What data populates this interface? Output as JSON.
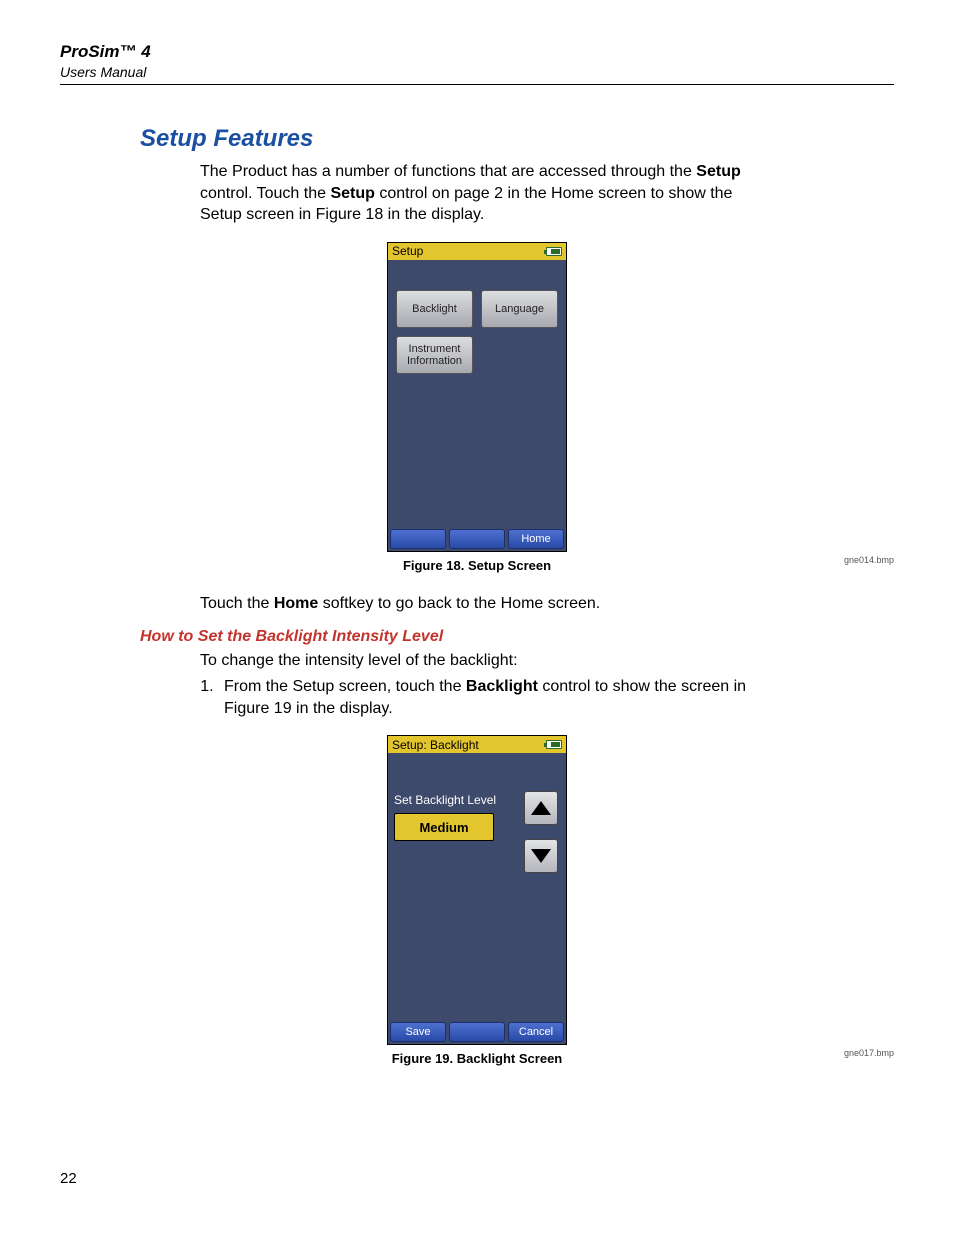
{
  "header": {
    "title": "ProSim™ 4",
    "subtitle": "Users Manual"
  },
  "section_heading": "Setup Features",
  "intro": {
    "part1": "The Product has a number of functions that are accessed through the ",
    "bold1": "Setup",
    "part2": " control. Touch the ",
    "bold2": "Setup",
    "part3": " control on page 2 in the Home screen to show the Setup screen in Figure 18 in the display."
  },
  "fig18": {
    "title": "Setup",
    "buttons": {
      "backlight": "Backlight",
      "language": "Language",
      "instrument_info": "Instrument\nInformation"
    },
    "softkeys": {
      "left": "",
      "mid": "",
      "right": "Home"
    },
    "caption": "Figure 18. Setup Screen",
    "bmp": "gne014.bmp"
  },
  "mid_para": {
    "part1": "Touch the ",
    "bold1": "Home",
    "part2": " softkey to go back to the Home screen."
  },
  "sub_heading": "How to Set the Backlight Intensity Level",
  "sub_intro": "To change the intensity level of the backlight:",
  "step1": {
    "part1": "From the Setup screen, touch the ",
    "bold1": "Backlight",
    "part2": " control to show the screen in Figure 19 in the display."
  },
  "fig19": {
    "title": "Setup: Backlight",
    "label": "Set Backlight Level",
    "value": "Medium",
    "softkeys": {
      "left": "Save",
      "mid": "",
      "right": "Cancel"
    },
    "caption": "Figure 19. Backlight Screen",
    "bmp": "gne017.bmp"
  },
  "page_number": "22"
}
